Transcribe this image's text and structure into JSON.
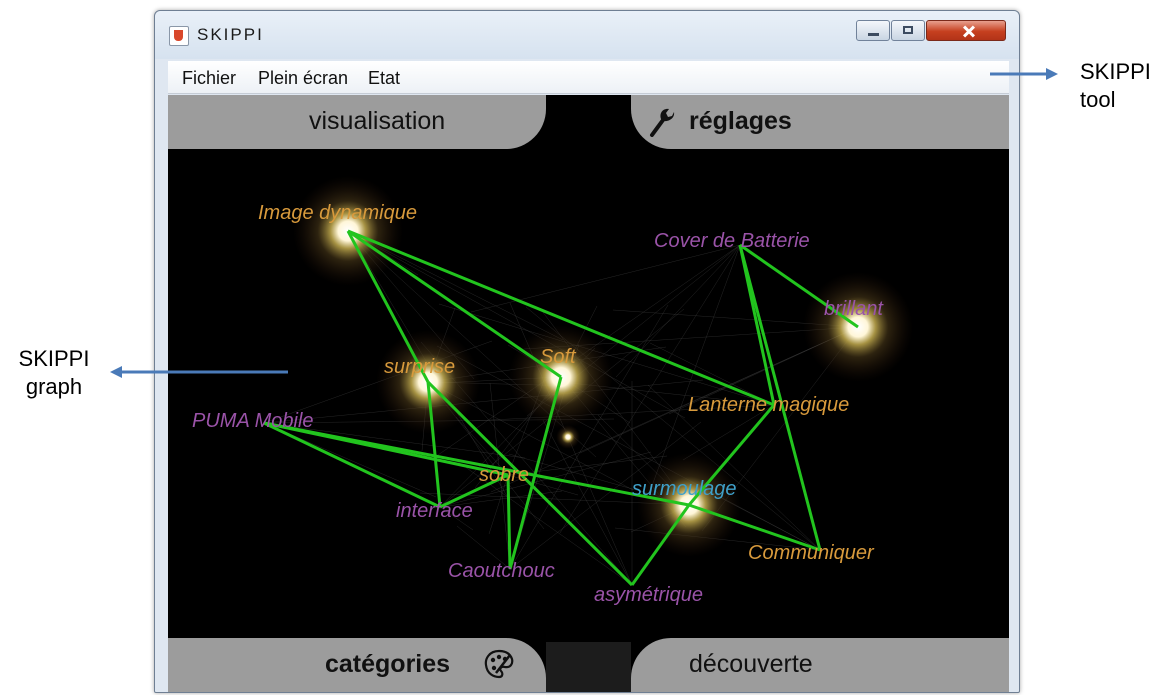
{
  "window": {
    "title": "SKIPPI"
  },
  "menu": [
    "Fichier",
    "Plein écran",
    "Etat"
  ],
  "tabs": {
    "visualisation": "visualisation",
    "reglages": "réglages",
    "categories": "catégories",
    "decouverte": "découverte"
  },
  "annotations": {
    "tool_line1": "SKIPPI",
    "tool_line2": "tool",
    "graph_line1": "SKIPPI",
    "graph_line2": "graph"
  },
  "graph": {
    "nodes": [
      {
        "id": "image",
        "label": "Image dynamique",
        "color": "#d89a3c"
      },
      {
        "id": "cover",
        "label": "Cover de Batterie",
        "color": "#9a53a8"
      },
      {
        "id": "brillant",
        "label": "brillant",
        "color": "#9a53a8"
      },
      {
        "id": "surprise",
        "label": "surprise",
        "color": "#d89a3c"
      },
      {
        "id": "soft",
        "label": "Soft",
        "color": "#d89a3c"
      },
      {
        "id": "lanterne",
        "label": "Lanterne magique",
        "color": "#d89a3c"
      },
      {
        "id": "puma",
        "label": "PUMA Mobile",
        "color": "#9a53a8"
      },
      {
        "id": "sobre",
        "label": "sobre",
        "color": "#d89a3c"
      },
      {
        "id": "surmoulage",
        "label": "surmoulage",
        "color": "#3fa0c9"
      },
      {
        "id": "interface",
        "label": "interface",
        "color": "#9a53a8"
      },
      {
        "id": "communiquer",
        "label": "Communiquer",
        "color": "#d89a3c"
      },
      {
        "id": "caoutchouc",
        "label": "Caoutchouc",
        "color": "#9a53a8"
      },
      {
        "id": "asymetrique",
        "label": "asymétrique",
        "color": "#9a53a8"
      }
    ],
    "edges": [
      [
        "image",
        "soft"
      ],
      [
        "image",
        "lanterne"
      ],
      [
        "image",
        "surprise"
      ],
      [
        "cover",
        "brillant"
      ],
      [
        "cover",
        "lanterne"
      ],
      [
        "cover",
        "communiquer"
      ],
      [
        "lanterne",
        "surmoulage"
      ],
      [
        "surmoulage",
        "communiquer"
      ],
      [
        "surmoulage",
        "asymetrique"
      ],
      [
        "surprise",
        "interface"
      ],
      [
        "surprise",
        "asymetrique"
      ],
      [
        "soft",
        "caoutchouc"
      ],
      [
        "puma",
        "surmoulage"
      ],
      [
        "puma",
        "sobre"
      ],
      [
        "puma",
        "interface"
      ],
      [
        "sobre",
        "caoutchouc"
      ],
      [
        "sobre",
        "interface"
      ]
    ],
    "edge_color": "#22c41e"
  }
}
